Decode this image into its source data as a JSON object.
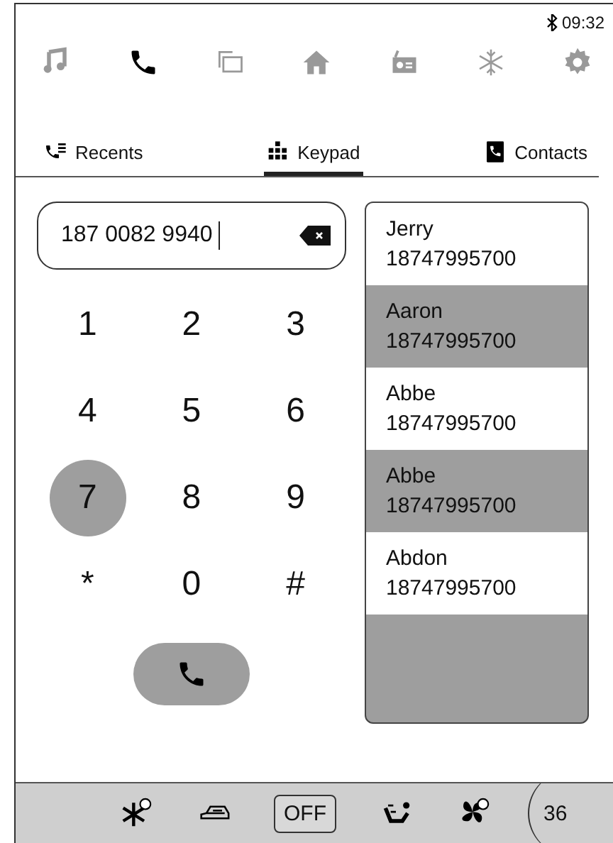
{
  "status_bar": {
    "time": "09:32"
  },
  "nav": [
    {
      "kind": "music",
      "selected": false
    },
    {
      "kind": "phone",
      "selected": true
    },
    {
      "kind": "mirror",
      "selected": false
    },
    {
      "kind": "home",
      "selected": false
    },
    {
      "kind": "radio",
      "selected": false
    },
    {
      "kind": "climate",
      "selected": false
    },
    {
      "kind": "settings",
      "selected": false
    }
  ],
  "tabs": [
    {
      "label": "Recents",
      "kind": "recents",
      "selected": false
    },
    {
      "label": "Keypad",
      "kind": "keypad",
      "selected": true
    },
    {
      "label": "Contacts",
      "kind": "contacts",
      "selected": false
    }
  ],
  "dial_field": {
    "value": "187 0082 9940"
  },
  "keys": [
    {
      "label": "1",
      "pressed": false
    },
    {
      "label": "2",
      "pressed": false
    },
    {
      "label": "3",
      "pressed": false
    },
    {
      "label": "4",
      "pressed": false
    },
    {
      "label": "5",
      "pressed": false
    },
    {
      "label": "6",
      "pressed": false
    },
    {
      "label": "7",
      "pressed": true
    },
    {
      "label": "8",
      "pressed": false
    },
    {
      "label": "9",
      "pressed": false
    },
    {
      "label": "*",
      "pressed": false
    },
    {
      "label": "0",
      "pressed": false
    },
    {
      "label": "#",
      "pressed": false
    }
  ],
  "contacts": [
    {
      "name": "Jerry",
      "number": "18747995700"
    },
    {
      "name": "Aaron",
      "number": "18747995700"
    },
    {
      "name": "Abbe",
      "number": "18747995700"
    },
    {
      "name": "Abbe",
      "number": "18747995700"
    },
    {
      "name": "Abdon",
      "number": "18747995700"
    }
  ],
  "climate_bar": [
    {
      "kind": "defrost"
    },
    {
      "kind": "recirculate"
    },
    {
      "kind": "off",
      "label": "OFF"
    },
    {
      "kind": "airflow"
    },
    {
      "kind": "fan"
    },
    {
      "kind": "view360",
      "label": "36"
    }
  ]
}
